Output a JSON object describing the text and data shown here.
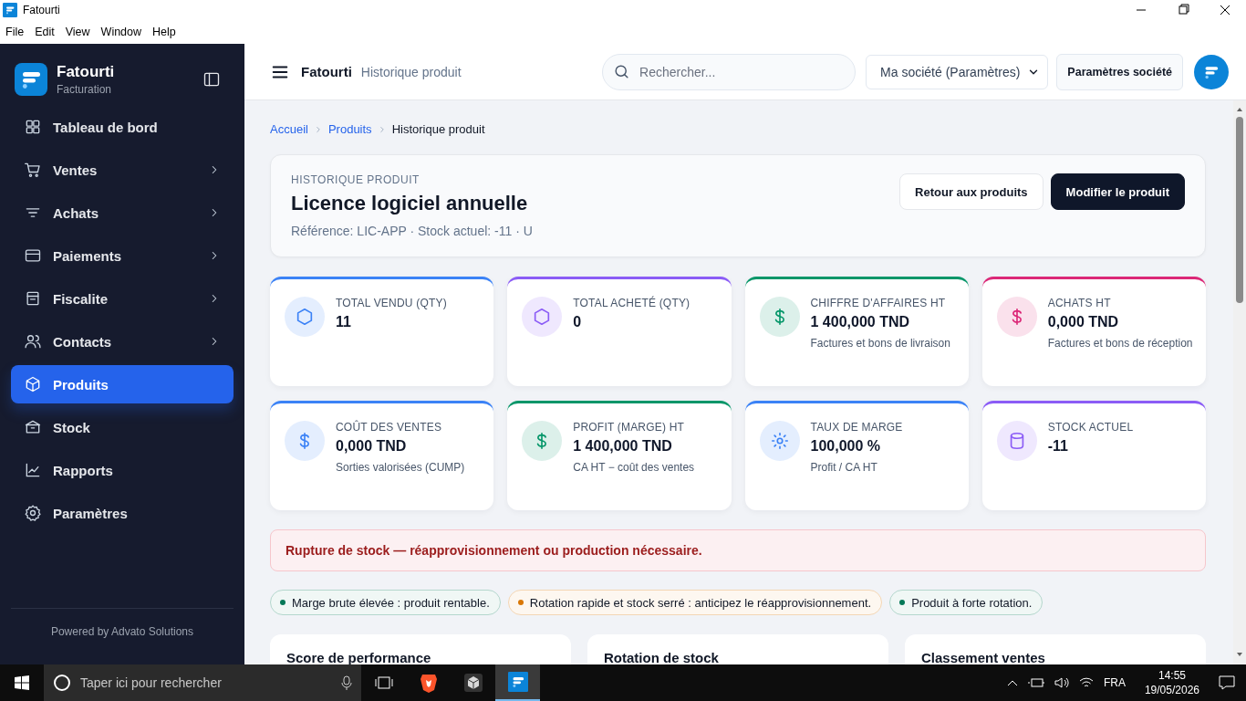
{
  "window": {
    "title": "Fatourti"
  },
  "menu_bar": [
    "File",
    "Edit",
    "View",
    "Window",
    "Help"
  ],
  "sidebar": {
    "brand": "Fatourti",
    "subtitle": "Facturation",
    "items": [
      {
        "label": "Tableau de bord",
        "expandable": false,
        "selected": false
      },
      {
        "label": "Ventes",
        "expandable": true,
        "selected": false
      },
      {
        "label": "Achats",
        "expandable": true,
        "selected": false
      },
      {
        "label": "Paiements",
        "expandable": true,
        "selected": false
      },
      {
        "label": "Fiscalite",
        "expandable": true,
        "selected": false
      },
      {
        "label": "Contacts",
        "expandable": true,
        "selected": false
      },
      {
        "label": "Produits",
        "expandable": false,
        "selected": true
      },
      {
        "label": "Stock",
        "expandable": false,
        "selected": false
      },
      {
        "label": "Rapports",
        "expandable": false,
        "selected": false
      },
      {
        "label": "Paramètres",
        "expandable": false,
        "selected": false
      }
    ],
    "footer": "Powered by Advato Solutions"
  },
  "header": {
    "app_name": "Fatourti",
    "page_title": "Historique produit",
    "search": {
      "placeholder": "Rechercher..."
    },
    "company_select": "Ma société (Paramètres)",
    "settings_button": "Paramètres société"
  },
  "breadcrumb": [
    {
      "label": "Accueil",
      "current": false
    },
    {
      "label": "Produits",
      "current": false
    },
    {
      "label": "Historique produit",
      "current": true
    }
  ],
  "product": {
    "eyebrow": "HISTORIQUE PRODUIT",
    "name": "Licence logiciel annuelle",
    "meta": "Référence: LIC-APP · Stock actuel: -11 · U",
    "buttons": [
      {
        "label": "Retour aux produits",
        "kind": "secondary"
      },
      {
        "label": "Modifier le produit",
        "kind": "primary"
      }
    ]
  },
  "stats": [
    {
      "label": "TOTAL VENDU (QTY)",
      "value": "11",
      "color": "#3b82f6"
    },
    {
      "label": "TOTAL ACHETÉ (QTY)",
      "value": "0",
      "color": "#8b5cf6"
    },
    {
      "label": "CHIFFRE D'AFFAIRES HT",
      "value": "1 400,000 TND",
      "note": "Factures et bons de livraison",
      "color": "#059669"
    },
    {
      "label": "ACHATS HT",
      "value": "0,000 TND",
      "note": "Factures et bons de réception",
      "color": "#db2777"
    },
    {
      "label": "COÛT DES VENTES",
      "value": "0,000 TND",
      "note": "Sorties valorisées (CUMP)",
      "color": "#3b82f6"
    },
    {
      "label": "PROFIT (MARGE) HT",
      "value": "1 400,000 TND",
      "note": "CA HT − coût des ventes",
      "color": "#059669"
    },
    {
      "label": "TAUX DE MARGE",
      "value": "100,000 %",
      "note": "Profit / CA HT",
      "color": "#3b82f6"
    },
    {
      "label": "STOCK ACTUEL",
      "value": "-11",
      "color": "#8b5cf6"
    }
  ],
  "alert": {
    "text": "Rupture de stock — réapprovisionnement ou production nécessaire."
  },
  "insights": [
    {
      "text": "Marge brute élevée : produit rentable.",
      "color": "#047857"
    },
    {
      "text": "Rotation rapide et stock serré : anticipez le réapprovisionnement.",
      "color": "#d97706"
    },
    {
      "text": "Produit à forte rotation.",
      "color": "#047857"
    }
  ],
  "panels": [
    {
      "title": "Score de performance"
    },
    {
      "title": "Rotation de stock"
    },
    {
      "title": "Classement ventes"
    }
  ],
  "taskbar": {
    "search_placeholder": "Taper ici pour rechercher",
    "language": "FRA",
    "time": "14:55",
    "date": "19/05/2026"
  }
}
